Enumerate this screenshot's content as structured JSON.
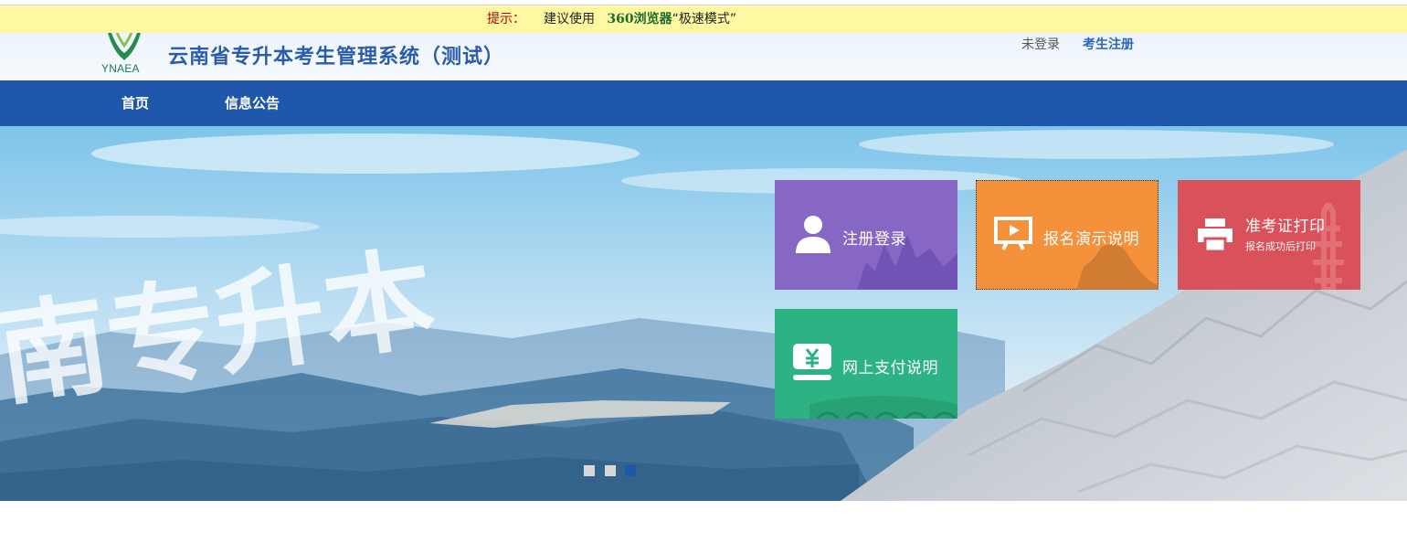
{
  "tip_bar": {
    "label": "提示：",
    "text_prefix": "建议使用",
    "browser": "360浏览器",
    "mode": "“极速模式”"
  },
  "header": {
    "logo_text": "YNAEA",
    "title": "云南省专升本考生管理系统（测试）",
    "login_status": "未登录",
    "register_link": "考生注册"
  },
  "nav": {
    "items": [
      {
        "label": "首页"
      },
      {
        "label": "信息公告"
      }
    ]
  },
  "banner": {
    "calligraphy": "南专升本",
    "tiles": [
      {
        "label": "注册登录",
        "icon": "user-icon",
        "color": "#8667c3"
      },
      {
        "label": "报名演示说明",
        "icon": "play-icon",
        "color": "#f4913a"
      },
      {
        "label": "准考证打印",
        "sublabel": "报名成功后打印",
        "icon": "printer-icon",
        "color": "#d9515a"
      },
      {
        "label": "网上支付说明",
        "icon": "yuan-icon",
        "color": "#2db383"
      }
    ],
    "slider": {
      "count": 3,
      "active_index": 3
    }
  },
  "colors": {
    "nav": "#1f58ab",
    "tip_bar": "#fff8a3",
    "title": "#2b5ba9"
  }
}
